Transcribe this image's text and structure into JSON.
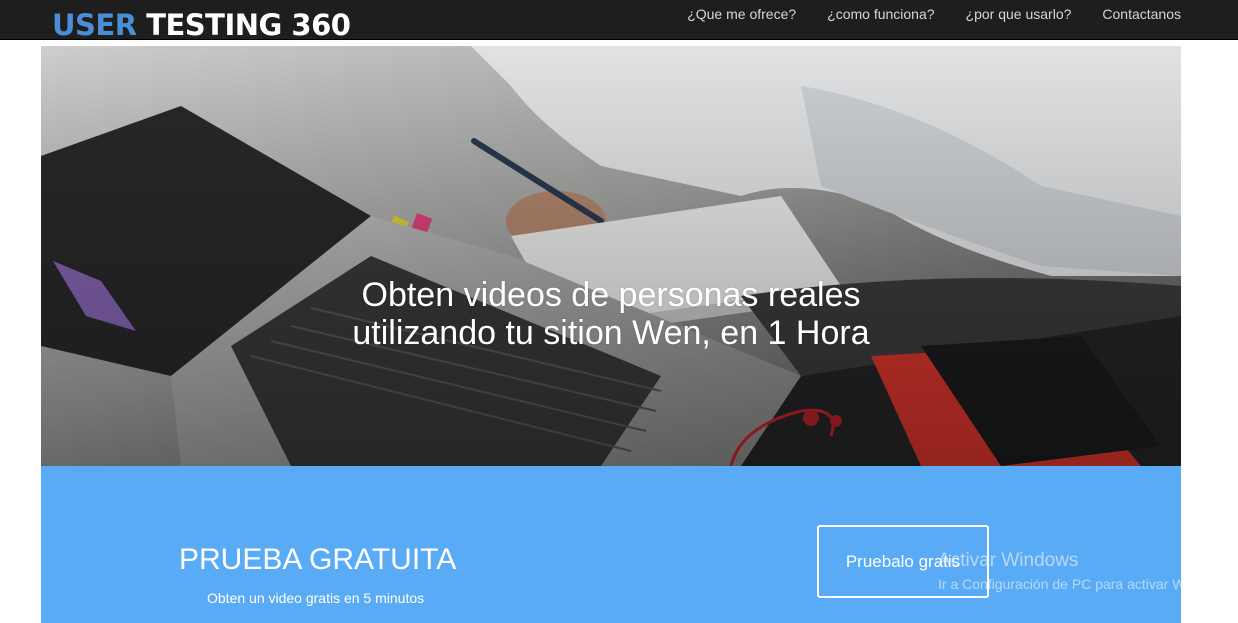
{
  "header": {
    "brand_part1": "USER",
    "brand_part2": "TESTING 360",
    "nav": [
      {
        "label": "¿Que me ofrece?"
      },
      {
        "label": "¿como funciona?"
      },
      {
        "label": "¿por que usarlo?"
      },
      {
        "label": "Contactanos"
      }
    ]
  },
  "hero": {
    "line1": "Obten videos de personas reales",
    "line2": "utilizando tu sition Wen, en 1 Hora"
  },
  "cta": {
    "title": "PRUEBA GRATUITA",
    "subtitle": "Obten un video gratis en 5 minutos",
    "button": "Pruebalo gratis"
  },
  "watermark": {
    "line1": "Activar Windows",
    "line2": "Ir a Configuración de PC para activar Windows."
  },
  "colors": {
    "nav_background": "#1e1e1e",
    "brand_accent": "#4a8fd6",
    "cta_background": "#5aabf5"
  }
}
